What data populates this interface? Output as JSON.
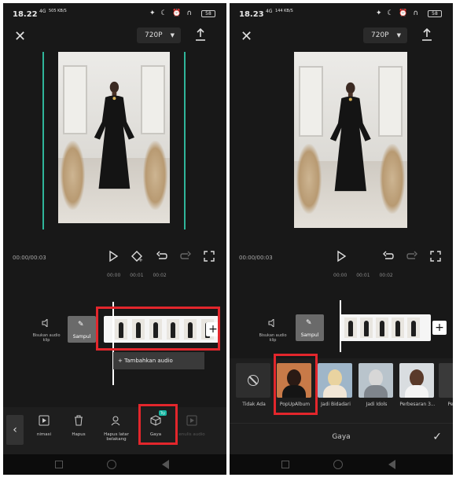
{
  "left": {
    "status": {
      "time": "18.22",
      "net": "4G",
      "netspeed": "505 KB/S",
      "battery": "58"
    },
    "topbar": {
      "resolution": "720P"
    },
    "timecode": "00:00/00:03",
    "ruler": [
      "00:00",
      "00:01",
      "00:02"
    ],
    "audio_label": "Bisukan audio klip",
    "cover_label": "Sampul",
    "add_audio": "+ Tambahkan audio",
    "tools": [
      {
        "label": "nimasi",
        "icon": "animation-icon"
      },
      {
        "label": "Hapus",
        "icon": "trash-icon"
      },
      {
        "label": "Hapus latar belakang",
        "icon": "remove-background-icon"
      },
      {
        "label": "Gaya",
        "icon": "cube-icon",
        "badge": "Try"
      },
      {
        "label": "enulis audio",
        "icon": "audio-icon"
      }
    ]
  },
  "right": {
    "status": {
      "time": "18.23",
      "net": "4G",
      "netspeed": "144 KB/S",
      "battery": "58"
    },
    "topbar": {
      "resolution": "720P"
    },
    "timecode": "00:00/00:03",
    "ruler": [
      "00:00",
      "00:01",
      "00:02"
    ],
    "audio_label": "Bisukan audio klip",
    "cover_label": "Sampul",
    "styles": [
      {
        "label": "Tidak Ada"
      },
      {
        "label": "PopUpAlbum"
      },
      {
        "label": "Jadi Bidadari"
      },
      {
        "label": "Jadi Idols"
      },
      {
        "label": "Perbesaran 3..."
      },
      {
        "label": "Pe"
      }
    ],
    "panel_title": "Gaya"
  },
  "colors": {
    "accent_red": "#e3262c",
    "guide_teal": "#2fb59a",
    "badge_teal": "#17b6a2"
  }
}
